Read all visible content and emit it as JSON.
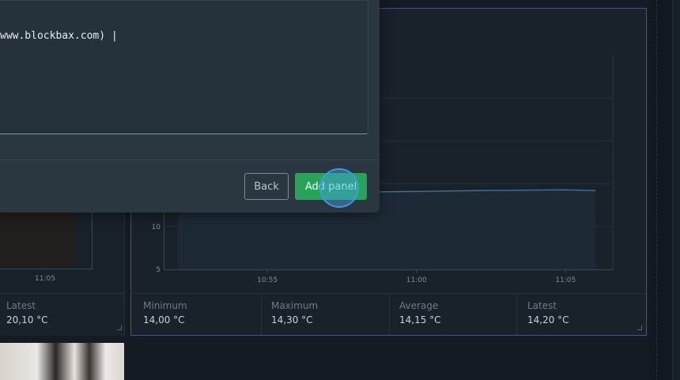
{
  "modal": {
    "code_text": "www.blockbax.com) |",
    "back_label": "Back",
    "add_label": "Add panel"
  },
  "left_widget": {
    "x_tick": "11:05",
    "stat_label": "Latest",
    "stat_value": "20,10 °C"
  },
  "chart_widget": {
    "stats": [
      {
        "label": "Minimum",
        "value": "14,00 °C"
      },
      {
        "label": "Maximum",
        "value": "14,30 °C"
      },
      {
        "label": "Average",
        "value": "14,15 °C"
      },
      {
        "label": "Latest",
        "value": "14,20 °C"
      }
    ]
  },
  "chart_data": {
    "type": "area",
    "x": [
      "10:52",
      "10:55",
      "10:57",
      "11:00",
      "11:02",
      "11:05",
      "11:06"
    ],
    "x_ticks": [
      "10:55",
      "11:00",
      "11:05"
    ],
    "y_ticks_visible": [
      "10",
      "5"
    ],
    "series": [
      {
        "values": [
          14.1,
          14.05,
          14.0,
          14.1,
          14.2,
          14.3,
          14.2
        ]
      }
    ],
    "ylim": [
      5,
      30
    ],
    "grid": true,
    "colors": {
      "line": "#3f6e93",
      "fill": "#1d2a36"
    }
  }
}
